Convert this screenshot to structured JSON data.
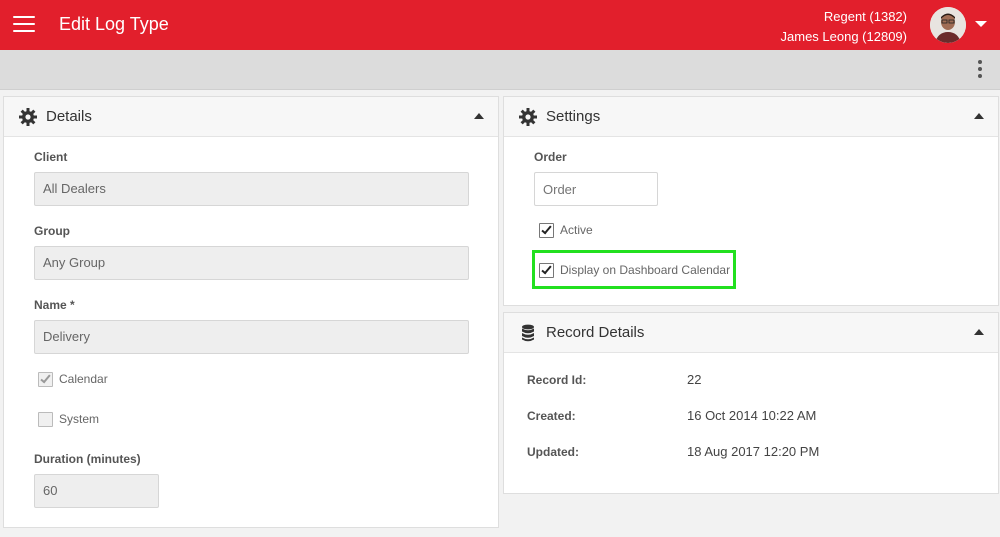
{
  "header": {
    "title": "Edit Log Type",
    "dealer": "Regent (1382)",
    "user": "James Leong (12809)"
  },
  "details": {
    "title": "Details",
    "client_label": "Client",
    "client_value": "All Dealers",
    "group_label": "Group",
    "group_value": "Any Group",
    "name_label": "Name *",
    "name_value": "Delivery",
    "calendar_label": "Calendar",
    "calendar_checked": true,
    "system_label": "System",
    "system_checked": false,
    "duration_label": "Duration (minutes)",
    "duration_value": "60"
  },
  "settings": {
    "title": "Settings",
    "order_label": "Order",
    "order_placeholder": "Order",
    "active_label": "Active",
    "active_checked": true,
    "dashboard_label": "Display on Dashboard Calendar",
    "dashboard_checked": true
  },
  "record": {
    "title": "Record Details",
    "id_label": "Record Id:",
    "id_value": "22",
    "created_label": "Created:",
    "created_value": "16 Oct 2014 10:22 AM",
    "updated_label": "Updated:",
    "updated_value": "18 Aug 2017 12:20 PM"
  },
  "colors": {
    "brand": "#e21f2c",
    "highlight": "#22e01f"
  }
}
